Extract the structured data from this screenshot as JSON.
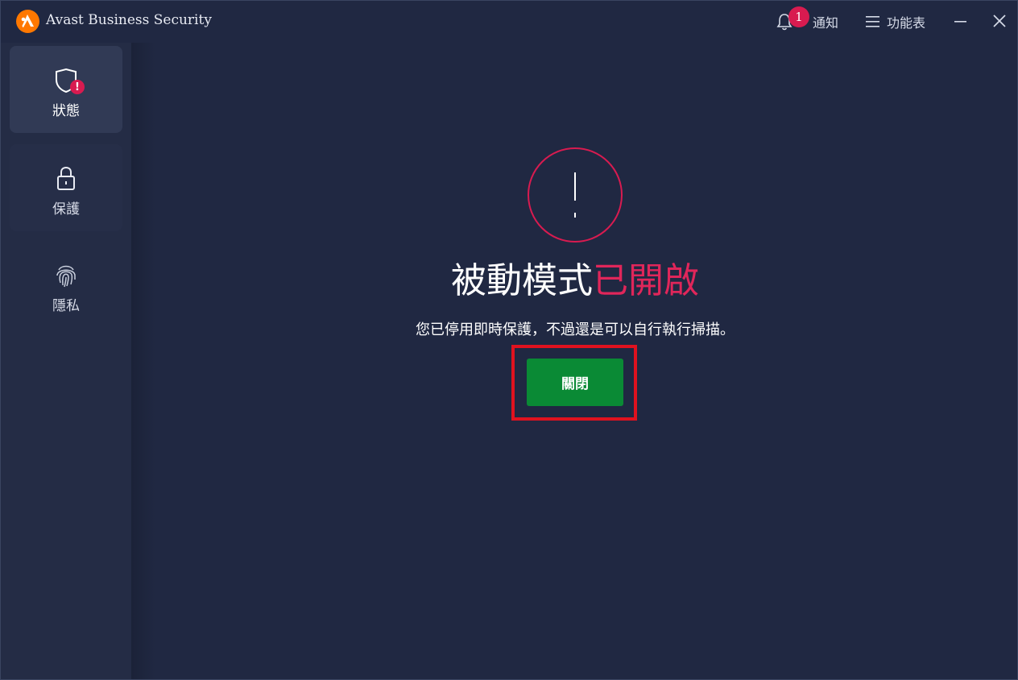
{
  "app": {
    "title": "Avast Business Security",
    "logo_icon": "avast-logo-icon",
    "brand_color": "#ff7800"
  },
  "header": {
    "notifications": {
      "icon": "bell-icon",
      "count": "1",
      "label": "通知"
    },
    "menu": {
      "icon": "hamburger-icon",
      "label": "功能表"
    },
    "window_controls": [
      "minimize-icon",
      "close-icon"
    ]
  },
  "sidebar": {
    "items": [
      {
        "label": "狀態",
        "icon": "shield-alert-icon",
        "alert": "!"
      },
      {
        "label": "保護",
        "icon": "lock-icon"
      },
      {
        "label": "隱私",
        "icon": "fingerprint-icon"
      }
    ]
  },
  "main": {
    "alert_icon": "exclamation-circle-icon",
    "heading_part1": "被動模式",
    "heading_part2": "已開啟",
    "subtext": "您已停用即時保護，不過還是可以自行執行掃描。",
    "close_button": "關閉"
  },
  "colors": {
    "background": "#202842",
    "alert": "#d81b50",
    "button": "#0a8a35",
    "highlight": "#e0121f"
  }
}
